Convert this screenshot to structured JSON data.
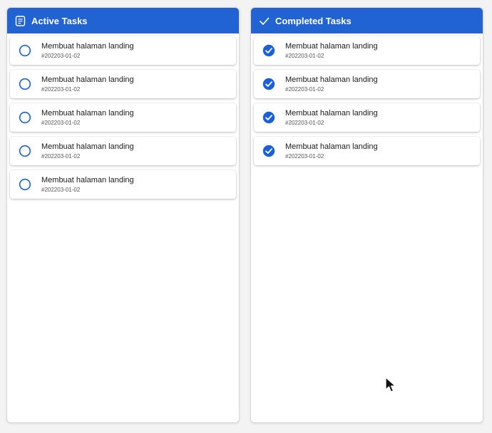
{
  "colors": {
    "accent": "#2163d3",
    "check": "#1a5fdc"
  },
  "active": {
    "title": "Active Tasks",
    "icon": "list-document-icon",
    "items": [
      {
        "title": "Membuat halaman landing",
        "id": "#202203-01-02"
      },
      {
        "title": "Membuat halaman landing",
        "id": "#202203-01-02"
      },
      {
        "title": "Membuat halaman landing",
        "id": "#202203-01-02"
      },
      {
        "title": "Membuat halaman landing",
        "id": "#202203-01-02"
      },
      {
        "title": "Membuat halaman landing",
        "id": "#202203-01-02"
      }
    ]
  },
  "completed": {
    "title": "Completed Tasks",
    "icon": "checkmark-icon",
    "items": [
      {
        "title": "Membuat halaman landing",
        "id": "#202203-01-02"
      },
      {
        "title": "Membuat halaman landing",
        "id": "#202203-01-02"
      },
      {
        "title": "Membuat halaman landing",
        "id": "#202203-01-02"
      },
      {
        "title": "Membuat halaman landing",
        "id": "#202203-01-02"
      }
    ]
  }
}
